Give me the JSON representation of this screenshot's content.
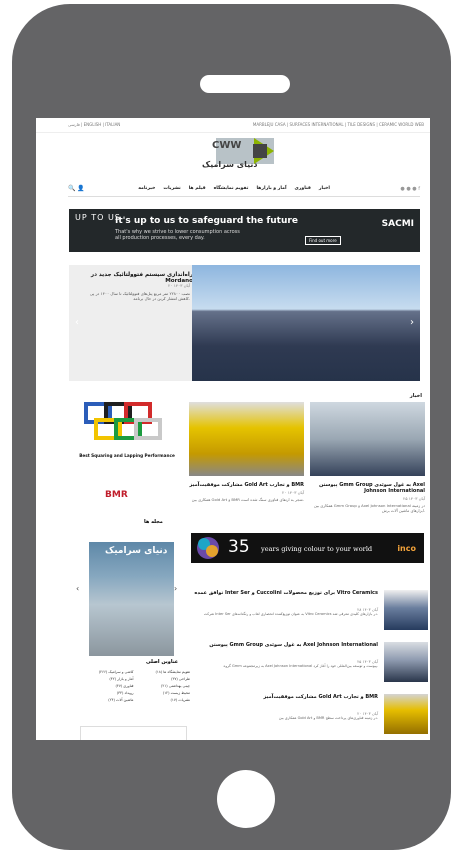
{
  "topbar": {
    "lang": "فارسی | ENGLISH | ITALIAN",
    "links": "MARBLEJU CASA | SURFACES INTERNATIONAL | TILE DESIGNS | CERAMIC WORLD WEB"
  },
  "logo": {
    "top": "CWW",
    "bottom": "دنیای سرامیک"
  },
  "nav": {
    "items": [
      "اخبار",
      "فناوری",
      "آمار و بازارها",
      "تقویم نمایشگاه",
      "فیلم ها",
      "نشریات",
      "خبرنامه"
    ],
    "icons": "🔍 👤"
  },
  "banner": {
    "upus": "UP TO US",
    "title": "It's up to us to safeguard the future",
    "subtitle": "That's why we strive to lower consumption across all production processes, every day.",
    "button": "Find out more",
    "brand": "SACMI"
  },
  "slider": {
    "title": "راه‌اندازی سیستم فتوولتائیک جدید در Mordano",
    "date": "۲۰ آبان ۱۴۰۳",
    "desc": "نصب ۲۲۸۰۰ متر مربع پنل‌های فتوولتائیک تا سال ۱۴۰۰ در پی کاهش انتشار کربن در حال برنامه.",
    "left_arrow": "‹",
    "right_arrow": "›"
  },
  "section": {
    "news": "اخبار",
    "magazine": "مجله ها",
    "categories": "عناوین اصلی"
  },
  "ads": {
    "ad1_text": "Best Squaring and Lapping Performance",
    "bmr": "BMR",
    "ad2_number": "35",
    "ad2_text": "years giving colour to your world",
    "ad2_brand": "inco"
  },
  "cards": [
    {
      "title": "پیوستن Gmm Group به غول سوئدی Axel Johnson International",
      "date": "۲۵ آبان ۱۴۰۳",
      "desc": "همکاری بین Gmm Group و Axel Johnson International در زمینه ابزارهای ماشین آلات برش."
    },
    {
      "title": "مشارکت موفقیت‌آمیز Gold Art و تجارب BMR",
      "date": "۲۰ آبان ۱۴۰۳",
      "desc": "همکاری بین Gold Art و BMR منجر به ارتقای فناوری سنگ شده است."
    }
  ],
  "magazine": {
    "title": "دنیای سرامیک",
    "left": "‹",
    "right": "›"
  },
  "categories": [
    "کاشی و سرامیک (۲۶۶)",
    "تقویم نمایشگاه ها (۱۸)",
    "آمار و بازار (۴۲)",
    "طراحی (۳۷)",
    "فناوری (۴۷)",
    "چینی بهداشتی (۲۱)",
    "رویداد (۳۳)",
    "محیط زیست (۱۲)",
    "ماشین آلات (۲۴)",
    "نشریات (۱۷)"
  ],
  "list": [
    {
      "title": "توافق عمده Inter Ser و Cuccolini برای توزیع محصولات Vitro Ceramics",
      "date": "۲۸ آبان ۱۴۰۳",
      "desc": "شرکت Inter Ser به عنوان توزیع‌کننده انحصاری لعاب و رنگدانه‌های Vitro Ceramics در بازارهای کلیدی معرفی شد."
    },
    {
      "title": "پیوستن Gmm Group به غول سوئدی Axel Johnson International",
      "date": "۲۵ آبان ۱۴۰۳",
      "desc": "گروه Gmm به زیرمجموعه Axel Johnson International پیوست و توسعه بین‌المللی خود را آغاز کرد."
    },
    {
      "title": "مشارکت موفقیت‌آمیز Gold Art و تجارب BMR",
      "date": "۲۰ آبان ۱۴۰۳",
      "desc": "همکاری بین Gold Art و BMR در زمینه فناوری‌های پرداخت سطح."
    }
  ]
}
